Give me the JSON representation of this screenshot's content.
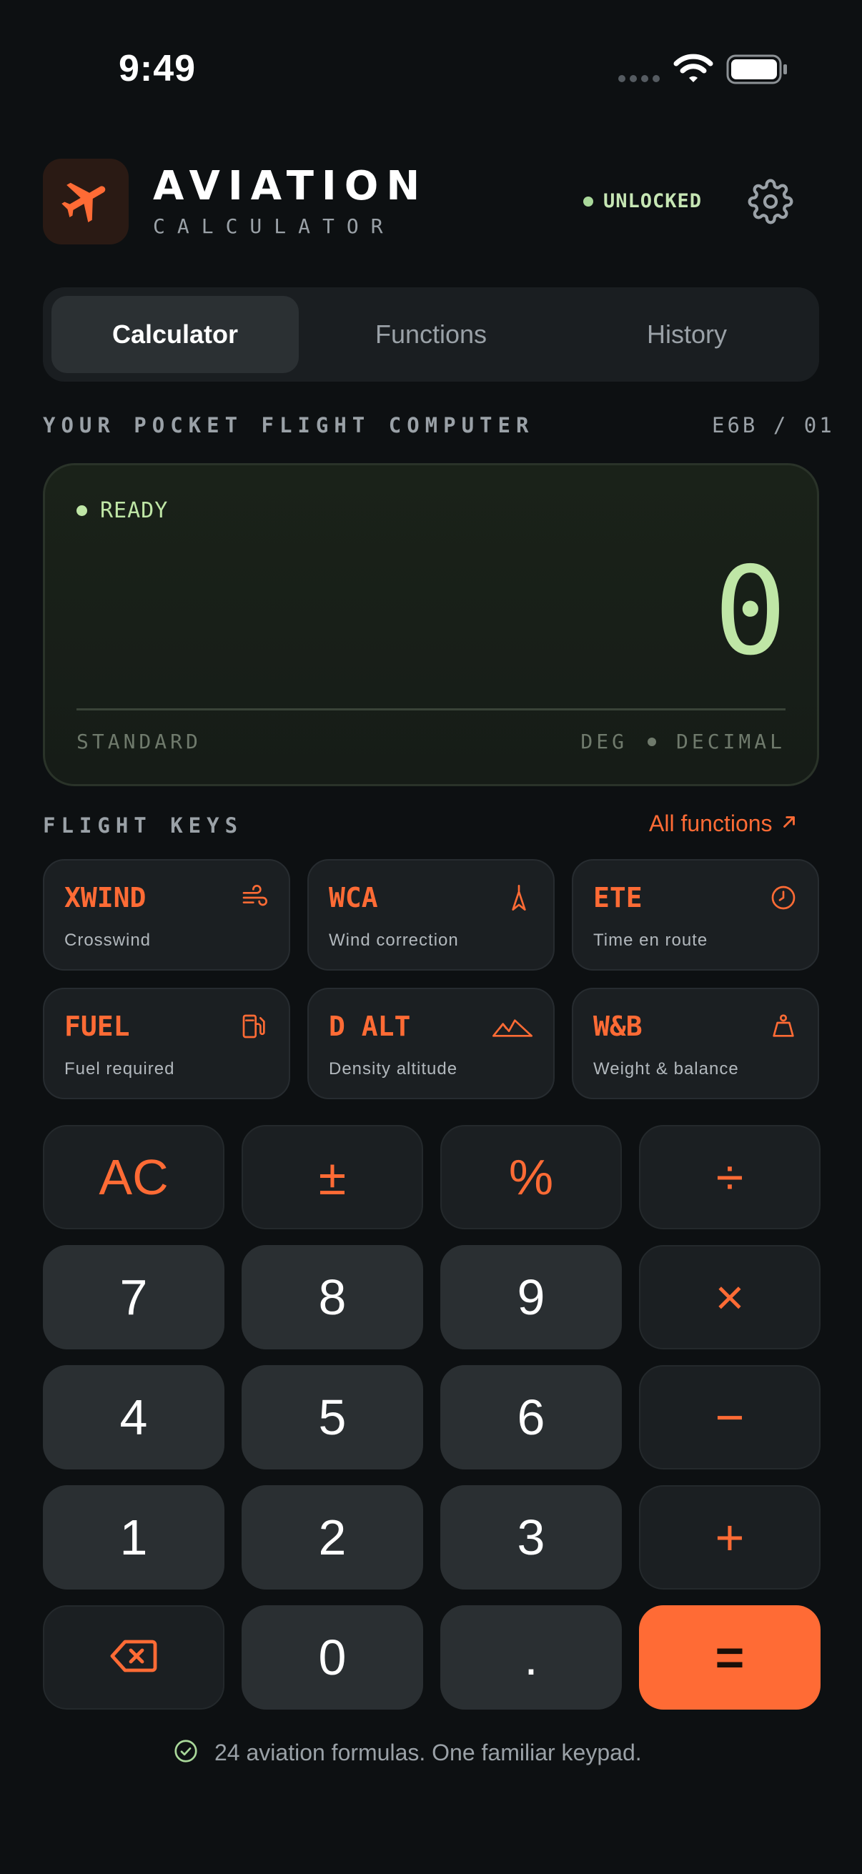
{
  "status_bar": {
    "time": "9:49"
  },
  "header": {
    "title": "AVIATION",
    "subtitle": "CALCULATOR",
    "status_label": "UNLOCKED"
  },
  "tabs": [
    {
      "label": "Calculator",
      "active": true
    },
    {
      "label": "Functions",
      "active": false
    },
    {
      "label": "History",
      "active": false
    }
  ],
  "section": {
    "title": "YOUR POCKET FLIGHT COMPUTER",
    "model": "E6B / 01"
  },
  "display": {
    "status": "READY",
    "value": "0",
    "mode": "STANDARD",
    "angle_unit": "DEG",
    "number_format": "DECIMAL"
  },
  "flight_keys": {
    "title": "FLIGHT KEYS",
    "link": "All functions",
    "items": [
      {
        "code": "XWIND",
        "desc": "Crosswind",
        "icon": "wind-icon"
      },
      {
        "code": "WCA",
        "desc": "Wind correction",
        "icon": "compass-needle-icon"
      },
      {
        "code": "ETE",
        "desc": "Time en route",
        "icon": "clock-icon"
      },
      {
        "code": "FUEL",
        "desc": "Fuel required",
        "icon": "fuel-pump-icon"
      },
      {
        "code": "D ALT",
        "desc": "Density altitude",
        "icon": "mountains-icon"
      },
      {
        "code": "W&B",
        "desc": "Weight & balance",
        "icon": "weight-icon"
      }
    ]
  },
  "keypad": {
    "ac": "AC",
    "plus_minus": "±",
    "percent": "%",
    "divide": "÷",
    "seven": "7",
    "eight": "8",
    "nine": "9",
    "multiply": "×",
    "four": "4",
    "five": "5",
    "six": "6",
    "minus": "−",
    "one": "1",
    "two": "2",
    "three": "3",
    "plus": "+",
    "zero": "0",
    "decimal": ".",
    "equals": "="
  },
  "footer": {
    "text": "24 aviation formulas. One familiar keypad."
  },
  "colors": {
    "accent": "#ff6b35",
    "display_text": "#bfe6a6",
    "background": "#0d1012"
  }
}
